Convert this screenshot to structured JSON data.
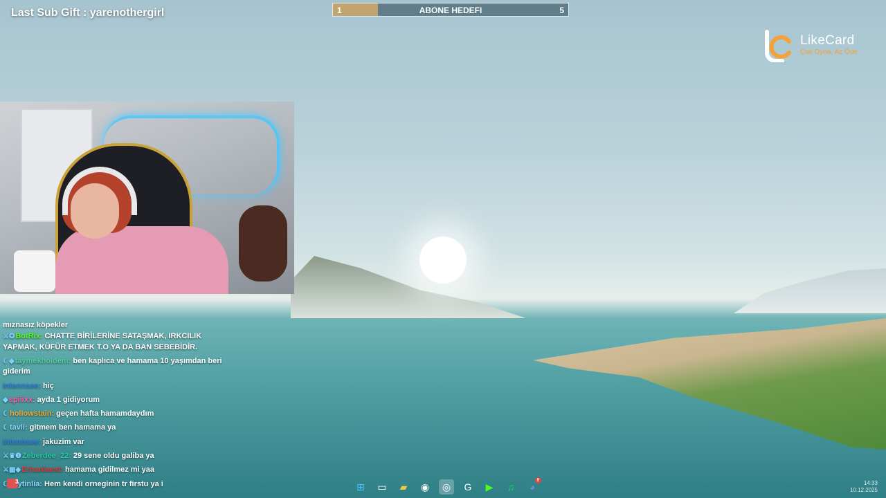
{
  "overlay": {
    "last_sub_gift": "Last Sub Gift : yarenothergirl"
  },
  "goal": {
    "start": "1",
    "title": "ABONE HEDEFI",
    "end": "5",
    "progress_fraction": 0.19,
    "fill_color": "#c2a56e",
    "bar_color": "#5f7d8a"
  },
  "sponsor": {
    "name": "LikeCard",
    "tagline": "Çok Oyna, Az Öde",
    "accent_color": "#f3a23a"
  },
  "chat": {
    "messages": [
      {
        "badges": "",
        "user": "",
        "text": "mıznasız köpekler",
        "user_color": "#ffffff",
        "truncated": true
      },
      {
        "badges": "⚔✪",
        "user": "BotRix:",
        "text": "CHATTE BİRİLERİNE SATAŞMAK, IRKCILIK YAPMAK, KÜFÜR ETMEK T.O YA DA BAN SEBEBİDİR.",
        "user_color": "#53fc18"
      },
      {
        "badges": "☾◆",
        "user": "taymekholdem:",
        "text": "ben kaplıca ve hamama 10 yaşımdan beri giderim",
        "user_color": "#4dd39b"
      },
      {
        "badges": "",
        "user": "Intennsee:",
        "text": "hiç",
        "user_color": "#2f7de1"
      },
      {
        "badges": "◆",
        "user": "spiiixx:",
        "text": "ayda 1 gidiyorum",
        "user_color": "#ff5fa2"
      },
      {
        "badges": "☾",
        "user": "hollowstain:",
        "text": "geçen hafta hamamdaydım",
        "user_color": "#f2a833"
      },
      {
        "badges": "☾",
        "user": "tavli:",
        "text": "gitmem ben hamama ya",
        "user_color": "#8fd3ff"
      },
      {
        "badges": "",
        "user": "Intennsee:",
        "text": "jakuzim var",
        "user_color": "#2f7de1"
      },
      {
        "badges": "⚔♛❶",
        "user": "Zeberdee_22:",
        "text": "29 sene oldu galiba ya",
        "user_color": "#28c9a5"
      },
      {
        "badges": "⚔▦◆",
        "user": "Erhanlaest:",
        "text": "hamama gidilmez mi yaa",
        "user_color": "#e03b3b"
      },
      {
        "badges": "☾",
        "user": "zeytinlia:",
        "text": "Hem kendi orneginin tr firstu ya i",
        "user_color": "#8fd3ff"
      }
    ],
    "notification_count": "3"
  },
  "taskbar": {
    "items": [
      {
        "name": "windows-start-icon",
        "glyph": "⊞",
        "color": "#4cc2ff"
      },
      {
        "name": "task-view-icon",
        "glyph": "▭",
        "color": "#ffffff"
      },
      {
        "name": "file-explorer-icon",
        "glyph": "▰",
        "color": "#f5c542"
      },
      {
        "name": "obs-icon",
        "glyph": "◉",
        "color": "#ffffff",
        "badge": ""
      },
      {
        "name": "chrome-icon",
        "glyph": "◎",
        "color": "#ffffff",
        "active": true
      },
      {
        "name": "g-app-icon",
        "glyph": "G",
        "color": "#ffffff"
      },
      {
        "name": "kick-icon",
        "glyph": "▶",
        "color": "#53fc18"
      },
      {
        "name": "spotify-icon",
        "glyph": "♫",
        "color": "#1ed760"
      },
      {
        "name": "discord-icon",
        "glyph": "◕",
        "color": "#7289da",
        "badge": "8"
      }
    ],
    "time": "14:33",
    "date": "10.12.2025"
  }
}
